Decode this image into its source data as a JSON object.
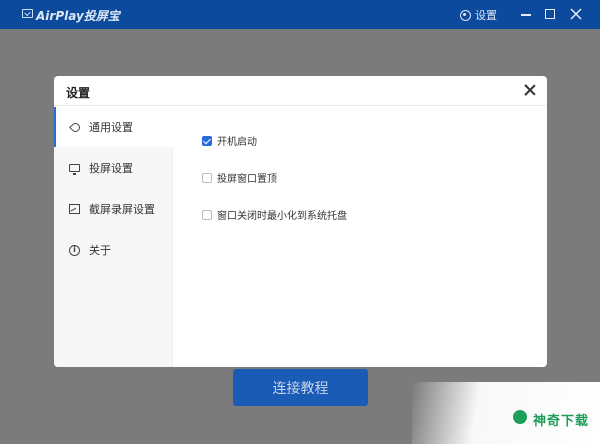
{
  "window": {
    "title": "AirPlay投屏宝",
    "settings_label": "设置"
  },
  "background": {
    "connect_button": "连接教程",
    "watermark": "神奇下载"
  },
  "dialog": {
    "title": "设置",
    "sidebar": {
      "items": [
        {
          "label": "通用设置",
          "icon": "wrench-icon",
          "active": true
        },
        {
          "label": "投屏设置",
          "icon": "monitor-icon",
          "active": false
        },
        {
          "label": "截屏录屏设置",
          "icon": "screenshot-icon",
          "active": false
        },
        {
          "label": "关于",
          "icon": "info-icon",
          "active": false
        }
      ]
    },
    "options": [
      {
        "label": "开机启动",
        "checked": true
      },
      {
        "label": "投屏窗口置顶",
        "checked": false
      },
      {
        "label": "窗口关闭时最小化到系统托盘",
        "checked": false
      }
    ]
  },
  "colors": {
    "titlebar": "#0b4a9c",
    "accent": "#2a6ad8",
    "overlay": "#7b7b7b",
    "connect_button": "#1a5bb5"
  }
}
